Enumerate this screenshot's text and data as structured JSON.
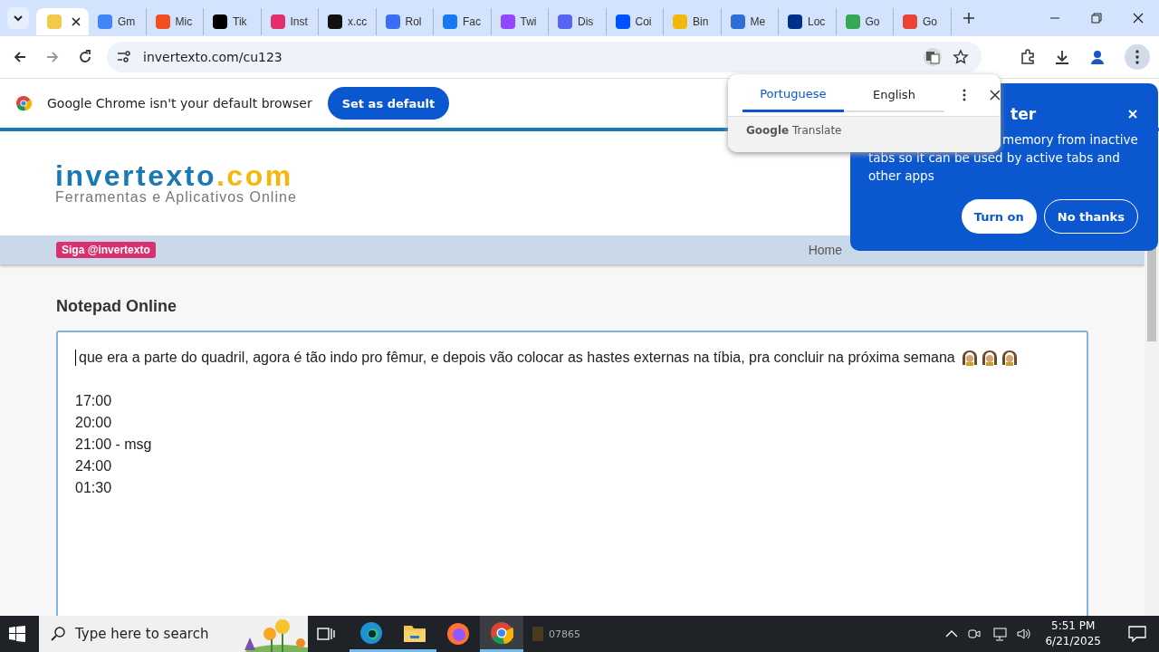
{
  "tabs": [
    {
      "selected": true,
      "color": "#f2c94c"
    },
    {
      "label": "Gm",
      "selected": false,
      "color": "#4285f4"
    },
    {
      "label": "Mic",
      "selected": false,
      "color": "#f25022"
    },
    {
      "label": "Tik",
      "selected": false,
      "color": "#000000"
    },
    {
      "label": "Inst",
      "selected": false,
      "color": "#e1306c"
    },
    {
      "label": "x.cc",
      "selected": false,
      "color": "#111111"
    },
    {
      "label": "Rol",
      "selected": false,
      "color": "#3b6ef5"
    },
    {
      "label": "Fac",
      "selected": false,
      "color": "#1877f2"
    },
    {
      "label": "Twi",
      "selected": false,
      "color": "#9146ff"
    },
    {
      "label": "Dis",
      "selected": false,
      "color": "#5865f2"
    },
    {
      "label": "Coi",
      "selected": false,
      "color": "#0052ff"
    },
    {
      "label": "Bin",
      "selected": false,
      "color": "#f0b90b"
    },
    {
      "label": "Me",
      "selected": false,
      "color": "#2d6fd6"
    },
    {
      "label": "Loc",
      "selected": false,
      "color": "#003087"
    },
    {
      "label": "Go",
      "selected": false,
      "color": "#34a853"
    },
    {
      "label": "Go",
      "selected": false,
      "color": "#ea4335"
    }
  ],
  "address": "invertexto.com/cu123",
  "infobar": {
    "message": "Google Chrome isn't your default browser",
    "button": "Set as default"
  },
  "translate": {
    "languages": [
      {
        "label": "Portuguese",
        "selected": true
      },
      {
        "label": "English",
        "selected": false
      }
    ],
    "footer_brand": "Google",
    "footer_text": "Translate"
  },
  "memory_bubble": {
    "title": "ter",
    "text": "memory from inactive tabs so it can be used by active tabs and other apps",
    "buttons": [
      "Turn on",
      "No thanks"
    ]
  },
  "site": {
    "logo_main": "invertexto",
    "logo_tld": ".com",
    "tagline": "Ferramentas e Aplicativos Online",
    "follow": "Siga @invertexto",
    "nav": [
      "Home"
    ],
    "heading": "Notepad Online",
    "note_lines": [
      "que era a parte do quadril, agora é tão indo pro fêmur, e depois vão colocar as hastes externas na tíbia, pra concluir na próxima semana",
      "17:00",
      "20:00",
      "21:00 - msg",
      "24:00",
      "01:30"
    ]
  },
  "taskbar": {
    "search_placeholder": "Type here to search",
    "window_label": "07865",
    "time": "5:51 PM",
    "date": "6/21/2025"
  }
}
